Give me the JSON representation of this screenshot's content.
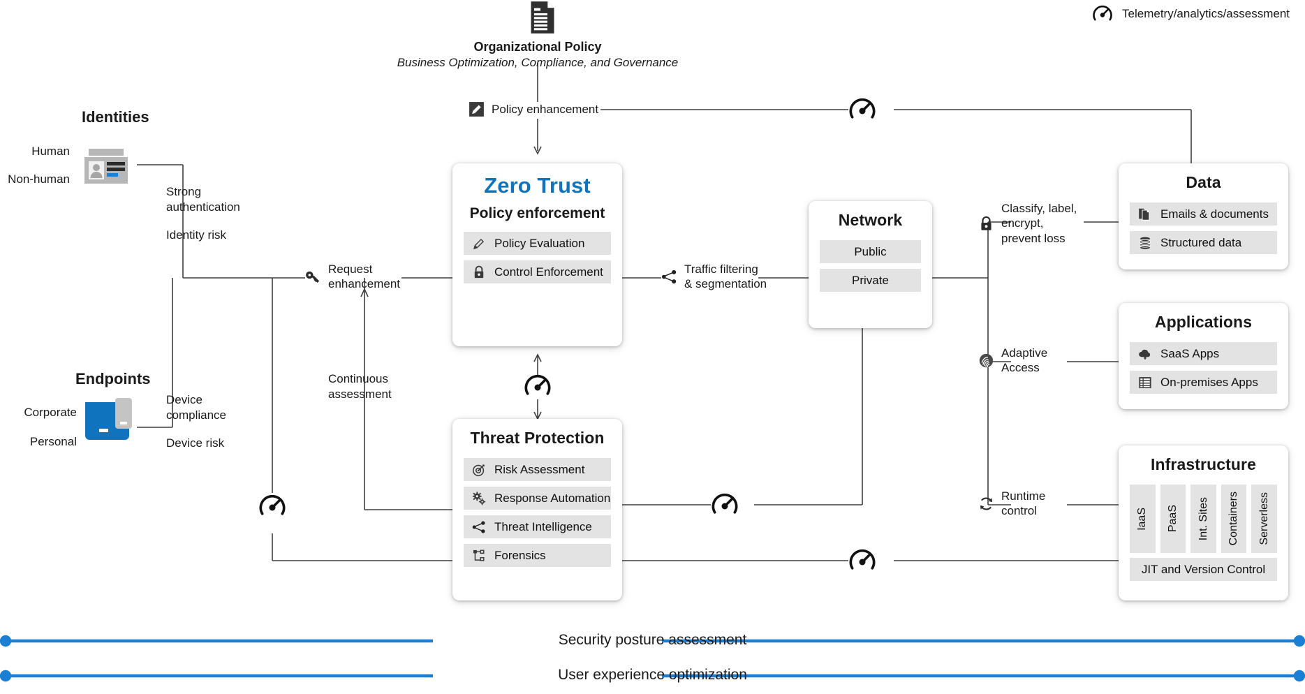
{
  "legend": {
    "icon": "gauge-icon",
    "label": "Telemetry/analytics/assessment"
  },
  "policy": {
    "icon": "document-icon",
    "title": "Organizational Policy",
    "subtitle": "Business Optimization, Compliance, and Governance",
    "enhancement_label": "Policy enhancement",
    "enhancement_icon": "edit-pencil-icon"
  },
  "identities": {
    "heading": "Identities",
    "types": [
      "Human",
      "Non-human"
    ],
    "glyph": "id-badge-icon",
    "signals": [
      "Strong\nauthentication",
      "Identity risk"
    ]
  },
  "endpoints": {
    "heading": "Endpoints",
    "types": [
      "Corporate",
      "Personal"
    ],
    "glyph": "laptop-phone-icon",
    "signals": [
      "Device\ncompliance",
      "Device risk"
    ]
  },
  "connectors": {
    "request_enhancement": {
      "icon": "key-icon",
      "label": "Request\nenhancement"
    },
    "continuous_assessment": {
      "label": "Continuous\nassessment"
    },
    "traffic_filtering": {
      "icon": "share-nodes-icon",
      "label": "Traffic filtering\n& segmentation"
    },
    "classify": {
      "icon": "lock-icon",
      "label": "Classify, label,\nencrypt,\nprevent loss"
    },
    "adaptive_access": {
      "icon": "fingerprint-icon",
      "label": "Adaptive\nAccess"
    },
    "runtime_control": {
      "icon": "refresh-cycle-icon",
      "label": "Runtime\ncontrol"
    }
  },
  "zero_trust": {
    "title": "Zero Trust",
    "title_color": "#0f74bd",
    "subtitle": "Policy enforcement",
    "items": [
      {
        "label": "Policy Evaluation",
        "icon": "pencil-icon"
      },
      {
        "label": "Control Enforcement",
        "icon": "lock-closed-icon"
      }
    ]
  },
  "threat_protection": {
    "title": "Threat Protection",
    "items": [
      {
        "label": "Risk Assessment",
        "icon": "target-icon"
      },
      {
        "label": "Response Automation",
        "icon": "gears-icon"
      },
      {
        "label": "Threat Intelligence",
        "icon": "share-nodes-icon"
      },
      {
        "label": "Forensics",
        "icon": "sitemap-icon"
      }
    ]
  },
  "network": {
    "title": "Network",
    "items": [
      {
        "label": "Public"
      },
      {
        "label": "Private"
      }
    ]
  },
  "data": {
    "title": "Data",
    "items": [
      {
        "label": "Emails & documents",
        "icon": "documents-copy-icon"
      },
      {
        "label": "Structured data",
        "icon": "database-icon"
      }
    ]
  },
  "applications": {
    "title": "Applications",
    "items": [
      {
        "label": "SaaS Apps",
        "icon": "cloud-download-icon"
      },
      {
        "label": "On-premises Apps",
        "icon": "server-rack-icon"
      }
    ]
  },
  "infrastructure": {
    "title": "Infrastructure",
    "columns": [
      "IaaS",
      "PaaS",
      "Int. Sites",
      "Containers",
      "Serverless"
    ],
    "footer": "JIT and Version Control"
  },
  "bottom_bars": [
    {
      "label": "Security posture assessment",
      "color": "#1b7fd4"
    },
    {
      "label": "User experience optimization",
      "color": "#1b7fd4"
    }
  ],
  "gauges": [
    {
      "name": "gauge-policy-enhancement"
    },
    {
      "name": "gauge-zero-trust-threat"
    },
    {
      "name": "gauge-threat-right"
    },
    {
      "name": "gauge-left-loop"
    },
    {
      "name": "gauge-bottom-loop"
    }
  ],
  "wire_color": "#3f3f3f"
}
